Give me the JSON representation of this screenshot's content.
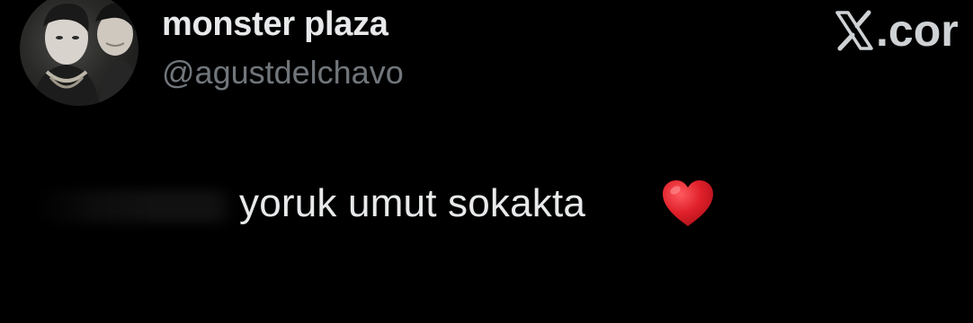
{
  "tweet": {
    "author": {
      "display_name": "monster plaza",
      "handle": "@agustdelchavo",
      "avatar_icon": "profile-photo"
    },
    "watermark": {
      "icon": "x-logo-icon",
      "text": ".cor"
    },
    "text": "yoruk umut sokakta",
    "emoji": "red-heart-icon"
  },
  "colors": {
    "background": "#000000",
    "primary_text": "#e7e9ea",
    "secondary_text": "#71767b",
    "heart": "#e0202a"
  }
}
